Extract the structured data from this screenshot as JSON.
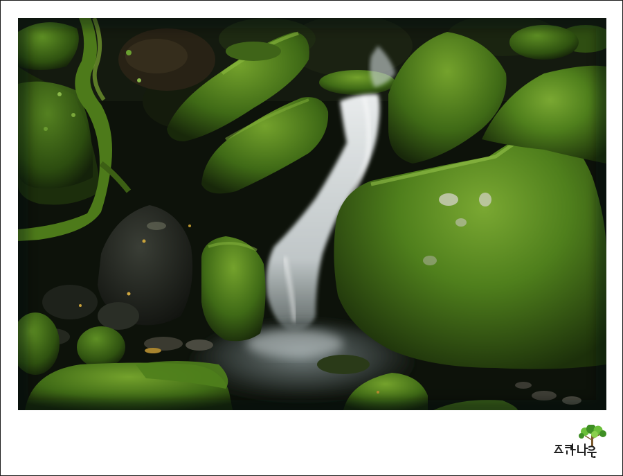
{
  "photo": {
    "subject_icons": [
      "waterfall",
      "moss-rock",
      "forest-floor"
    ]
  },
  "signature": {
    "text": "느티나무",
    "colors": {
      "ink": "#1e1e1e",
      "leaf": "#6bbf3a",
      "leaf_dark": "#3f8f24",
      "trunk": "#7a5a2e"
    }
  },
  "palette": {
    "moss_bright": "#6a9a2a",
    "moss_mid": "#3f6a18",
    "moss_dark": "#233d0c",
    "rock_dark": "#1a1e18",
    "water": "#e8eef0",
    "shadow": "#0b0f08"
  }
}
